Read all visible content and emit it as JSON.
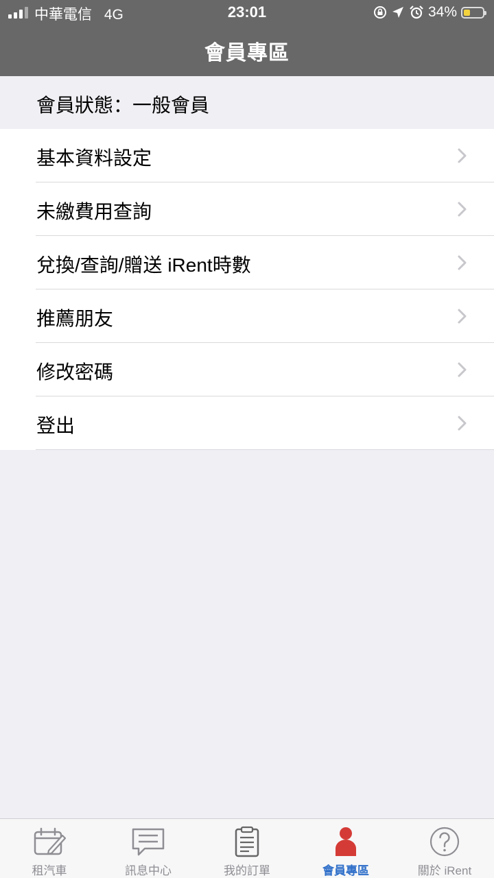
{
  "status_bar": {
    "carrier": "中華電信",
    "network": "4G",
    "time": "23:01",
    "battery_percent": "34%",
    "battery_level": 0.34,
    "icons": [
      "signal-icon",
      "orientation-lock-icon",
      "location-icon",
      "alarm-icon",
      "battery-icon"
    ]
  },
  "nav": {
    "title": "會員專區"
  },
  "member": {
    "status_text": "會員狀態：一般會員"
  },
  "menu": {
    "items": [
      {
        "label": "基本資料設定"
      },
      {
        "label": "未繳費用查詢"
      },
      {
        "label": "兌換/查詢/贈送 iRent時數"
      },
      {
        "label": "推薦朋友"
      },
      {
        "label": "修改密碼"
      },
      {
        "label": "登出"
      }
    ]
  },
  "tabbar": {
    "tabs": [
      {
        "label": "租汽車",
        "icon": "car-rental-icon",
        "active": false
      },
      {
        "label": "訊息中心",
        "icon": "message-icon",
        "active": false
      },
      {
        "label": "我的訂單",
        "icon": "clipboard-icon",
        "active": false
      },
      {
        "label": "會員專區",
        "icon": "person-icon",
        "active": true
      },
      {
        "label": "關於 iRent",
        "icon": "question-icon",
        "active": false
      }
    ]
  },
  "colors": {
    "nav_background": "#686868",
    "page_background": "#efeff4",
    "active_tab_label": "#2f6fc9",
    "active_tab_icon": "#d43b36",
    "inactive_tab": "#8e8e93",
    "battery_fill": "#f4d33f"
  }
}
